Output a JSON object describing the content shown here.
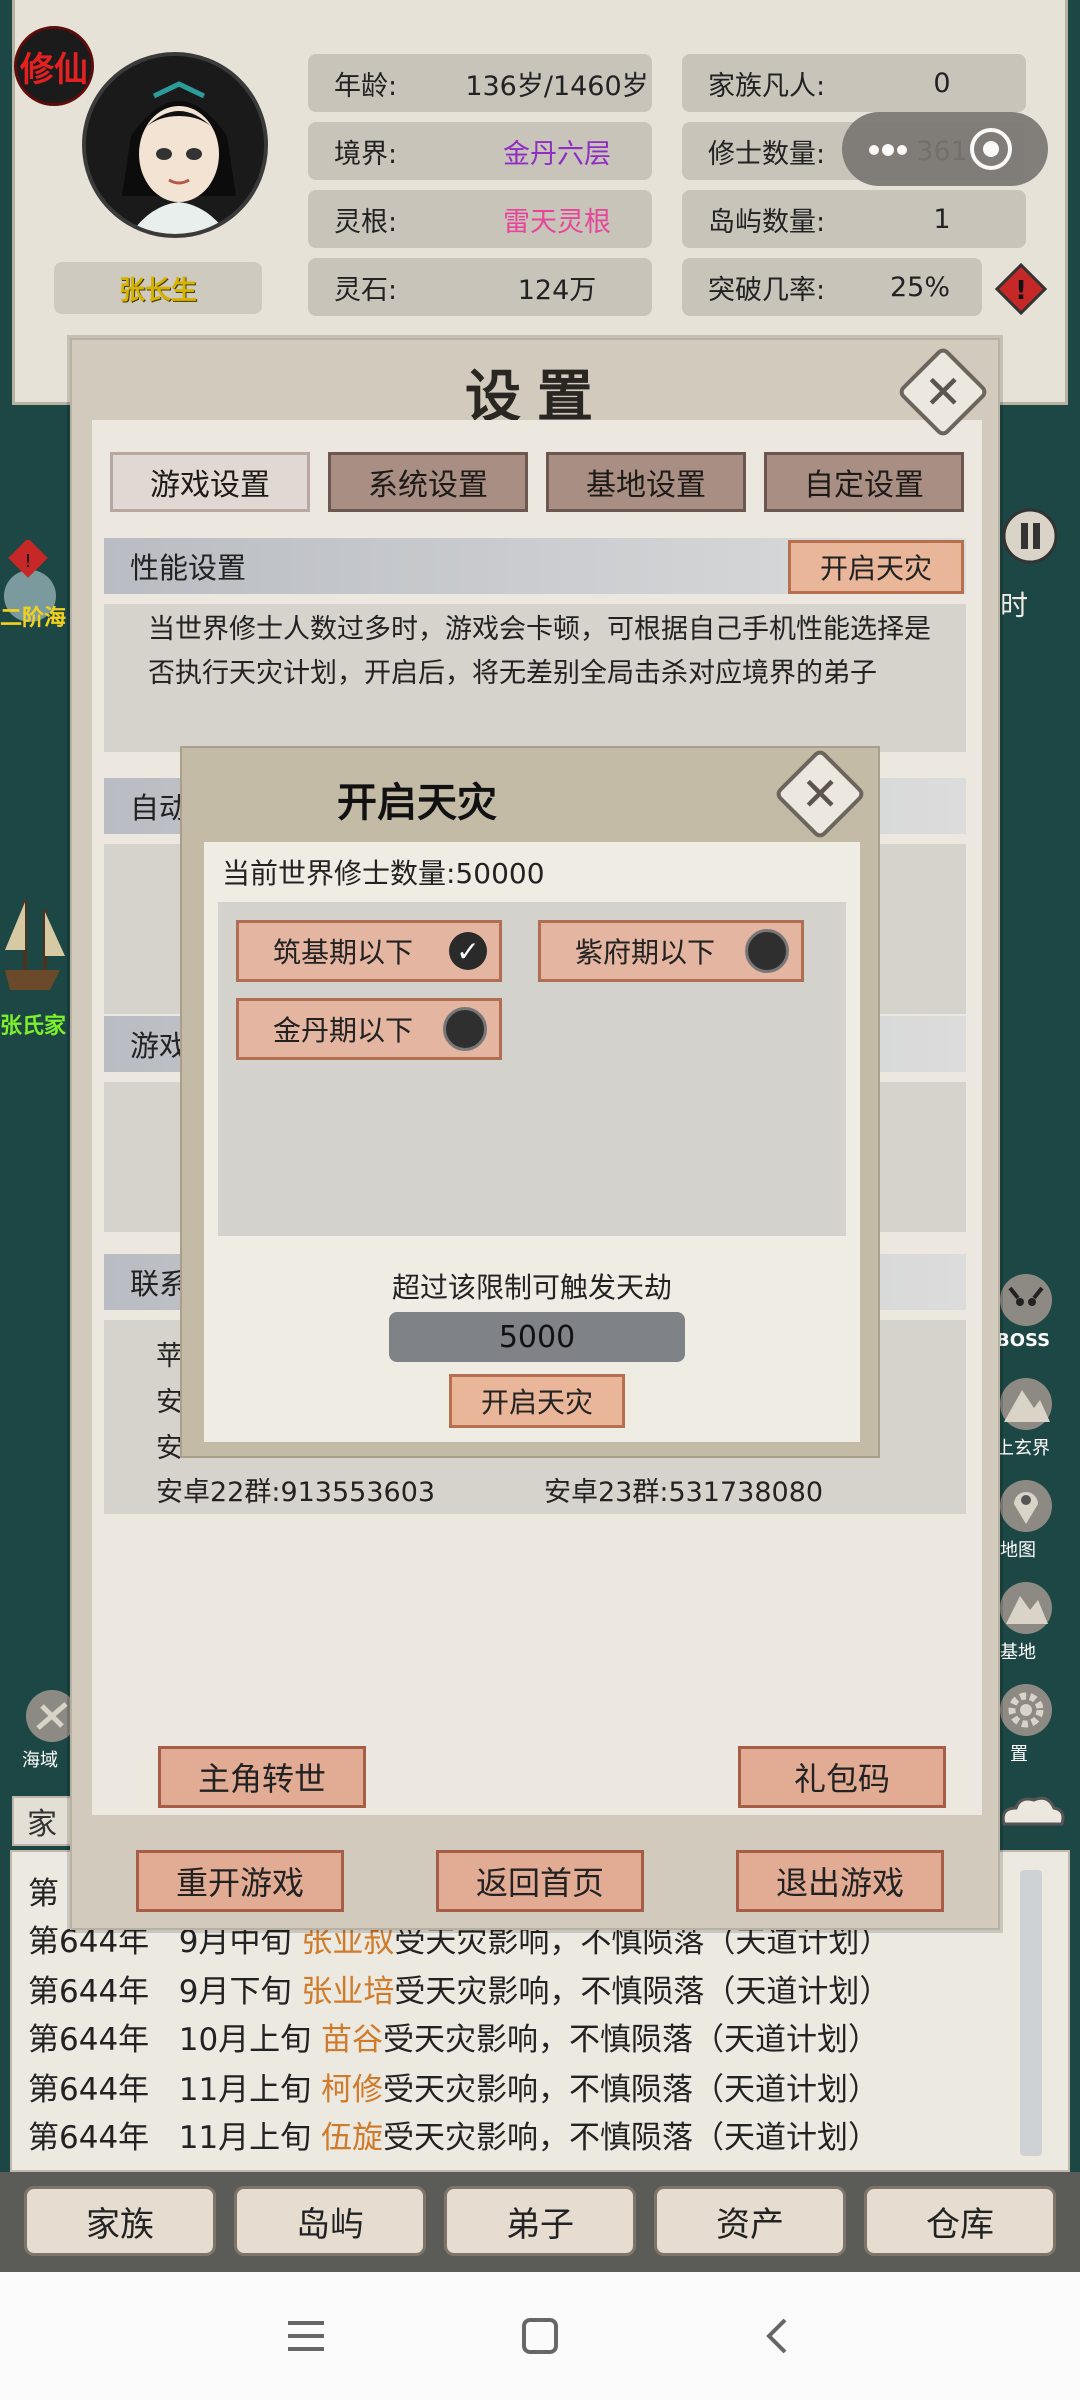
{
  "player": {
    "badge": "修仙",
    "name": "张长生",
    "stats": [
      {
        "label": "年龄:",
        "value": "136岁/1460岁"
      },
      {
        "label": "境界:",
        "value": "金丹六层"
      },
      {
        "label": "灵根:",
        "value": "雷天灵根"
      },
      {
        "label": "灵石:",
        "value": "124万"
      },
      {
        "label": "家族凡人:",
        "value": "0"
      },
      {
        "label": "修士数量:",
        "value": "361"
      },
      {
        "label": "岛屿数量:",
        "value": "1"
      },
      {
        "label": "突破几率:",
        "value": "25%"
      }
    ]
  },
  "side_labels": {
    "left1": "二阶海",
    "left2": "张氏家",
    "right_t": "时",
    "boss": "BOSS",
    "r_xuanjie": "上玄界",
    "r_ditu": "地图",
    "r_jidi": "基地",
    "r_shezhi": "置",
    "haiyu": "海域"
  },
  "settings": {
    "title": "设置",
    "tabs": [
      "游戏设置",
      "系统设置",
      "基地设置",
      "自定设置"
    ],
    "perf_header": "性能设置",
    "perf_button": "开启天灾",
    "perf_desc": "当世界修士人数过多时，游戏会卡顿，可根据自己手机性能选择是否执行天灾计划，开启后，将无差别全局击杀对应境界的弟子",
    "sec2_header": "自动",
    "sec3_header": "游戏",
    "sec4_header": "联系",
    "qq_partial": [
      "苹",
      "安",
      "安"
    ],
    "qq_row": [
      {
        "label": "安卓22群:",
        "value": "913553603"
      },
      {
        "label": "安卓23群:",
        "value": "531738080"
      }
    ],
    "reincarnate_button": "主角转世",
    "gift_button": "礼包码",
    "restart_button": "重开游戏",
    "home_button": "返回首页",
    "exit_button": "退出游戏"
  },
  "calamity": {
    "title": "开启天灾",
    "world_count_label": "当前世界修士数量:50000",
    "options": [
      {
        "label": "筑基期以下",
        "checked": true
      },
      {
        "label": "紫府期以下",
        "checked": false
      },
      {
        "label": "金丹期以下",
        "checked": false
      }
    ],
    "limit_label": "超过该限制可触发天劫",
    "limit_value": "5000",
    "confirm_button": "开启天灾"
  },
  "log": {
    "tab_partial": "家",
    "first_partial": "第",
    "lines": [
      {
        "year": "第644年",
        "time": "9月中旬",
        "name": "张业叔",
        "text": "受天灾影响，不慎陨落（天道计划）"
      },
      {
        "year": "第644年",
        "time": "9月下旬",
        "name": "张业培",
        "text": "受天灾影响，不慎陨落（天道计划）"
      },
      {
        "year": "第644年",
        "time": "10月上旬",
        "name": "苗谷",
        "text": "受天灾影响，不慎陨落（天道计划）"
      },
      {
        "year": "第644年",
        "time": "11月上旬",
        "name": "柯修",
        "text": "受天灾影响，不慎陨落（天道计划）"
      },
      {
        "year": "第644年",
        "time": "11月上旬",
        "name": "伍旋",
        "text": "受天灾影响，不慎陨落（天道计划）"
      }
    ]
  },
  "nav": [
    "家族",
    "岛屿",
    "弟子",
    "资产",
    "仓库"
  ],
  "colors": {
    "accent_name": "#d07a2a",
    "realm_purple": "#8f2ec2",
    "root_pink": "#e6469a",
    "name_gold": "#d4b400"
  }
}
